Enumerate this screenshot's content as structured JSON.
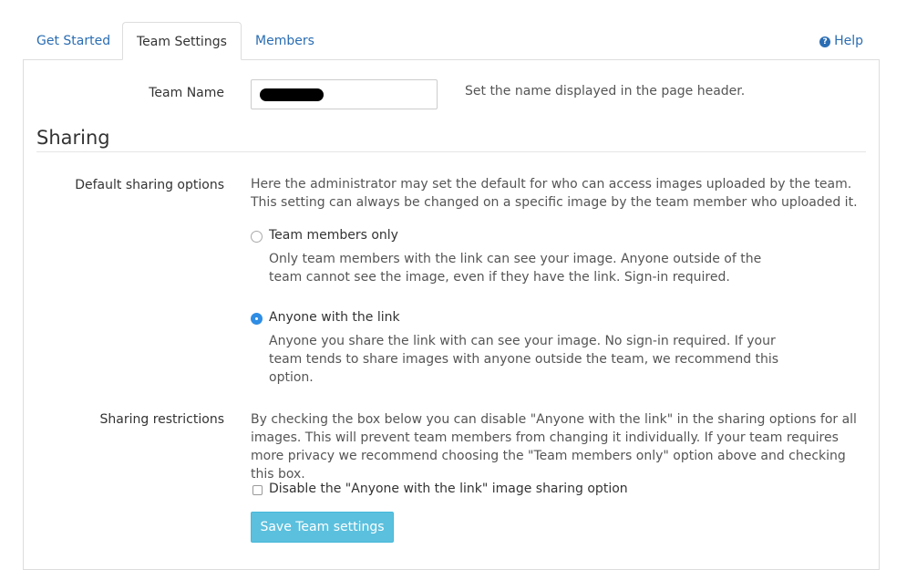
{
  "tabs": [
    {
      "label": "Get Started",
      "active": false
    },
    {
      "label": "Team Settings",
      "active": true
    },
    {
      "label": "Members",
      "active": false
    }
  ],
  "help": {
    "label": "Help",
    "icon": "question-circle-icon"
  },
  "team_name": {
    "label": "Team Name",
    "value_redacted": true,
    "hint": "Set the name displayed in the page header."
  },
  "sharing": {
    "title": "Sharing",
    "default_label": "Default sharing options",
    "default_description": "Here the administrator may set the default for who can access images uploaded by the team. This setting can always be changed on a specific image by the team member who uploaded it.",
    "options": [
      {
        "label": "Team members only",
        "description": "Only team members with the link can see your image. Anyone outside of the team cannot see the image, even if they have the link. Sign-in required.",
        "selected": false
      },
      {
        "label": "Anyone with the link",
        "description": "Anyone you share the link with can see your image. No sign-in required. If your team tends to share images with anyone outside the team, we recommend this option.",
        "selected": true
      }
    ],
    "restrictions_label": "Sharing restrictions",
    "restrictions_description": "By checking the box below you can disable \"Anyone with the link\" in the sharing options for all images. This will prevent team members from changing it individually. If your team requires more privacy we recommend choosing the \"Team members only\" option above and checking this box.",
    "disable_option_label": "Disable the \"Anyone with the link\" image sharing option",
    "disable_option_checked": false
  },
  "save_button": {
    "label": "Save Team settings"
  },
  "colors": {
    "accent": "#2a6db3",
    "button": "#5bc0de",
    "radio_selected": "#2f8de4"
  }
}
